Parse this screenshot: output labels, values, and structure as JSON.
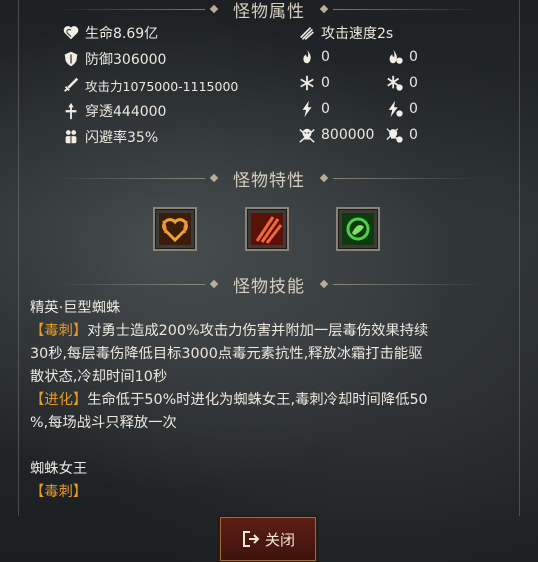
{
  "sections": {
    "attributes_title": "怪物属性",
    "traits_title": "怪物特性",
    "skills_title": "怪物技能"
  },
  "stats_left": [
    {
      "icon": "heart-icon",
      "text": "生命8.69亿"
    },
    {
      "icon": "shield-icon",
      "text": "防御306000"
    },
    {
      "icon": "sword-icon",
      "text": "攻击力1075000-1115000"
    },
    {
      "icon": "pierce-icon",
      "text": "穿透444000"
    },
    {
      "icon": "dodge-icon",
      "text": "闪避率35%"
    }
  ],
  "attack_speed": {
    "icon": "speed-icon",
    "text": "攻击速度2s"
  },
  "stats_right": [
    {
      "icon_a": "fire-attack-icon",
      "value_a": "0",
      "icon_b": "fire-resist-icon",
      "value_b": "0"
    },
    {
      "icon_a": "ice-attack-icon",
      "value_a": "0",
      "icon_b": "ice-resist-icon",
      "value_b": "0"
    },
    {
      "icon_a": "lightning-attack-icon",
      "value_a": "0",
      "icon_b": "lightning-resist-icon",
      "value_b": "0"
    },
    {
      "icon_a": "poison-attack-icon",
      "value_a": "800000",
      "icon_b": "poison-resist-icon",
      "value_b": "0"
    }
  ],
  "traits": [
    {
      "icon": "heart-flame-trait-icon",
      "color": "#e8942a"
    },
    {
      "icon": "claw-slash-trait-icon",
      "color": "#d8452a"
    },
    {
      "icon": "poison-cloud-trait-icon",
      "color": "#3fbf3a"
    }
  ],
  "skills": {
    "monster_name": "精英·巨型蜘蛛",
    "skill1_tag": "【毒刺】",
    "skill1_desc_1": "对勇士造成200%攻击力伤害并附加一层毒伤效果持续",
    "skill1_desc_2": "30秒,每层毒伤降低目标3000点毒元素抗性,释放冰霜打击能驱",
    "skill1_desc_3": "散状态,冷却时间10秒",
    "skill2_tag": "【进化】",
    "skill2_desc_1": "生命低于50%时进化为蜘蛛女王,毒刺冷却时间降低50",
    "skill2_desc_2": "%,每场战斗只释放一次",
    "evolved_name": "蜘蛛女王",
    "skill3_tag": "【毒刺】"
  },
  "close_button": {
    "label": "关闭",
    "icon": "exit-icon"
  },
  "colors": {
    "tag": "#e79b25",
    "text": "#ece8e0",
    "button_bg": "#4e1911"
  }
}
